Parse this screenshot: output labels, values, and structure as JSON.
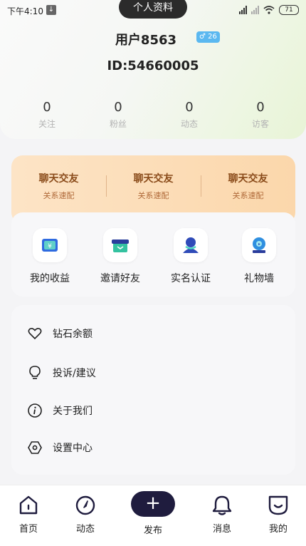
{
  "status_bar": {
    "time": "下午4:10",
    "battery": "71"
  },
  "title": "个人资料",
  "profile": {
    "username": "用户8563",
    "gender_age": "♂ 26",
    "user_id": "ID:54660005"
  },
  "stats": [
    {
      "value": "0",
      "label": "关注"
    },
    {
      "value": "0",
      "label": "粉丝"
    },
    {
      "value": "0",
      "label": "动态"
    },
    {
      "value": "0",
      "label": "访客"
    }
  ],
  "promo": [
    {
      "title": "聊天交友",
      "subtitle": "关系速配"
    },
    {
      "title": "聊天交友",
      "subtitle": "关系速配"
    },
    {
      "title": "聊天交友",
      "subtitle": "关系速配"
    }
  ],
  "tools": [
    {
      "label": "我的收益",
      "icon": "earnings-ticket-icon"
    },
    {
      "label": "邀请好友",
      "icon": "gift-box-icon"
    },
    {
      "label": "实名认证",
      "icon": "verified-person-icon"
    },
    {
      "label": "礼物墙",
      "icon": "gift-wall-icon"
    }
  ],
  "menu": [
    {
      "label": "钻石余额",
      "icon": "heart-icon"
    },
    {
      "label": "投诉/建议",
      "icon": "lightbulb-icon"
    },
    {
      "label": "关于我们",
      "icon": "info-icon"
    },
    {
      "label": "设置中心",
      "icon": "hexagon-settings-icon"
    }
  ],
  "tabbar": [
    {
      "label": "首页",
      "icon": "home-icon"
    },
    {
      "label": "动态",
      "icon": "compass-icon"
    },
    {
      "label": "发布",
      "icon": "plus-icon"
    },
    {
      "label": "消息",
      "icon": "bell-icon"
    },
    {
      "label": "我的",
      "icon": "smile-profile-icon"
    }
  ],
  "colors": {
    "accent": "#1f1c3e",
    "promo_text": "#8a4b1a",
    "badge": "#5bb8f0"
  }
}
